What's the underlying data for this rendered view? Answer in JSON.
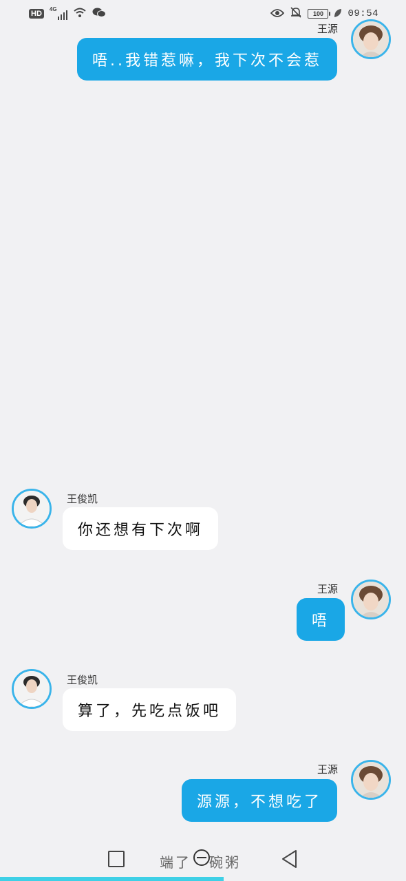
{
  "status_bar": {
    "network_badge": "HD",
    "network_type": "4G",
    "battery": "100",
    "time": "09:54",
    "icons": [
      "wifi-icon",
      "wechat-icon",
      "eye-icon",
      "bell-off-icon",
      "leaf-icon"
    ]
  },
  "messages": [
    {
      "sender": "王源",
      "direction": "out",
      "text": "唔..我错惹嘛，我下次不会惹"
    },
    {
      "sender": "王俊凯",
      "direction": "in",
      "text": "你还想有下次啊"
    },
    {
      "sender": "王源",
      "direction": "out",
      "text": "唔"
    },
    {
      "sender": "王俊凯",
      "direction": "in",
      "text": "算了，先吃点饭吧"
    },
    {
      "sender": "王源",
      "direction": "out",
      "text": "源源，不想吃了"
    }
  ],
  "bottom": {
    "draft_text_a": "端了",
    "draft_text_b": "碗粥",
    "nav_icons": [
      "recents-square-icon",
      "home-circle-icon",
      "back-triangle-icon"
    ]
  },
  "colors": {
    "outgoing_bubble": "#1aa7e6",
    "incoming_bubble": "#ffffff",
    "background": "#f1f1f3",
    "avatar_ring": "#3ab4ea",
    "progress": "#3fd0e6"
  },
  "reading_progress_fraction": 0.55
}
